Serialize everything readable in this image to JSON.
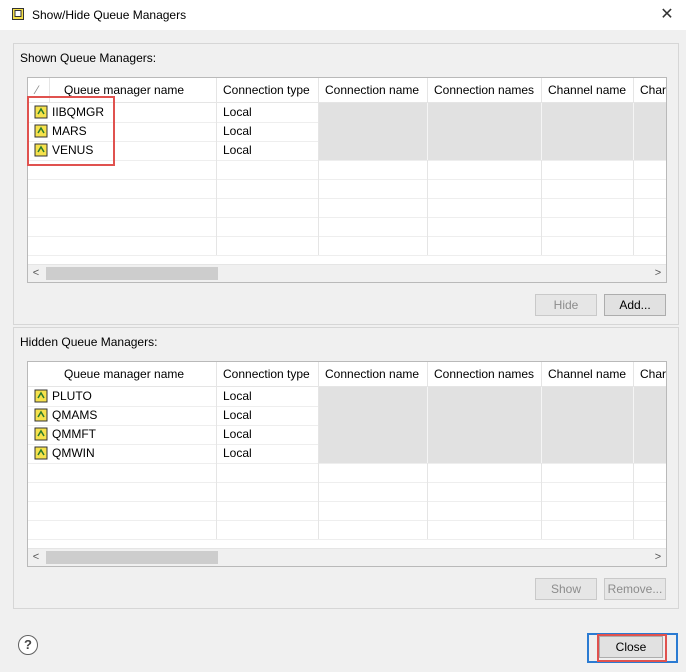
{
  "window": {
    "title": "Show/Hide Queue Managers"
  },
  "columns": [
    "Queue manager name",
    "Connection type",
    "Connection name",
    "Connection names",
    "Channel name",
    "Char"
  ],
  "shown": {
    "label": "Shown Queue Managers:",
    "rows": [
      {
        "name": "IIBQMGR",
        "type": "Local"
      },
      {
        "name": "MARS",
        "type": "Local"
      },
      {
        "name": "VENUS",
        "type": "Local"
      }
    ],
    "hide_label": "Hide",
    "add_label": "Add..."
  },
  "hidden": {
    "label": "Hidden Queue Managers:",
    "rows": [
      {
        "name": "PLUTO",
        "type": "Local"
      },
      {
        "name": "QMAMS",
        "type": "Local"
      },
      {
        "name": "QMMFT",
        "type": "Local"
      },
      {
        "name": "QMWIN",
        "type": "Local"
      }
    ],
    "show_label": "Show",
    "remove_label": "Remove..."
  },
  "footer": {
    "close_label": "Close",
    "help_glyph": "?"
  },
  "icons": {
    "app": "queue-manager-app-icon",
    "row": "queue-manager-icon"
  },
  "colors": {
    "highlight": "#e0524f",
    "focus": "#2b7bd2",
    "grey_cell": "#e1e1e1"
  }
}
